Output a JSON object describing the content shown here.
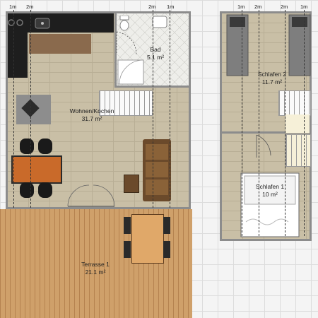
{
  "rooms": {
    "living": {
      "name": "Wohnen/Kochen",
      "area": "31.7 m²"
    },
    "bath": {
      "name": "Bad",
      "area": "5.1 m²"
    },
    "bedroom2": {
      "name": "Schlafen 2",
      "area": "11.7 m²"
    },
    "bedroom1": {
      "name": "Schlafen 1",
      "area": "10 m²"
    },
    "terrace": {
      "name": "Terrasse 1",
      "area": "21.1 m²"
    }
  },
  "dimension_markers": [
    "1m",
    "2m",
    "2m",
    "1m",
    "1m",
    "2m",
    "2m",
    "1m"
  ],
  "colors": {
    "wall": "#8c8c8c",
    "stone_floor": "#c9bfa6",
    "wood_deck": "#cfa06a",
    "tile_floor": "#eeeeea",
    "counter": "#1e1e1e",
    "sofa": "#6b4a2b",
    "chair": "#1a1a1a"
  },
  "icons": [
    "stove-icon",
    "sink-icon",
    "toilet-icon",
    "shower-icon",
    "bed-icon",
    "sofa-icon",
    "dining-chair-icon"
  ]
}
